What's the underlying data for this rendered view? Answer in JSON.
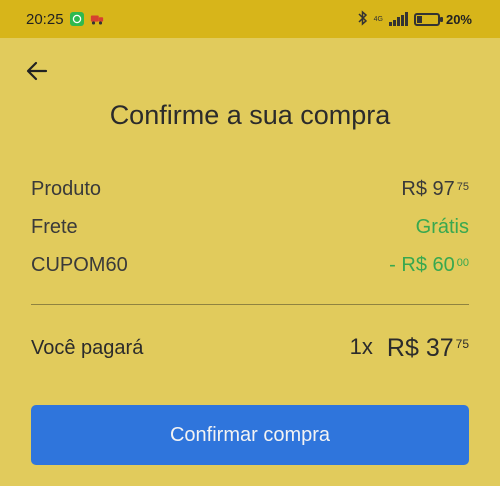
{
  "status_bar": {
    "time": "20:25",
    "network": "4G",
    "battery_percent": "20%"
  },
  "header": {
    "back_icon": "arrow-left-icon",
    "title": "Confirme a sua compra"
  },
  "summary": {
    "rows": [
      {
        "label": "Produto",
        "amount_main": "R$ 97",
        "amount_cents": "75"
      },
      {
        "label": "Frete",
        "amount_main": "Grátis",
        "amount_cents": ""
      },
      {
        "label": "CUPOM60",
        "amount_main": "- R$ 60",
        "amount_cents": "00"
      }
    ]
  },
  "total": {
    "label": "Você pagará",
    "installments": "1x",
    "amount_main": "R$ 37",
    "amount_cents": "75"
  },
  "actions": {
    "confirm_label": "Confirmar compra"
  },
  "colors": {
    "background": "#e1cb5c",
    "status_bar": "#d7b51a",
    "accent_green": "#38a84f",
    "button_blue": "#2f75dc"
  }
}
